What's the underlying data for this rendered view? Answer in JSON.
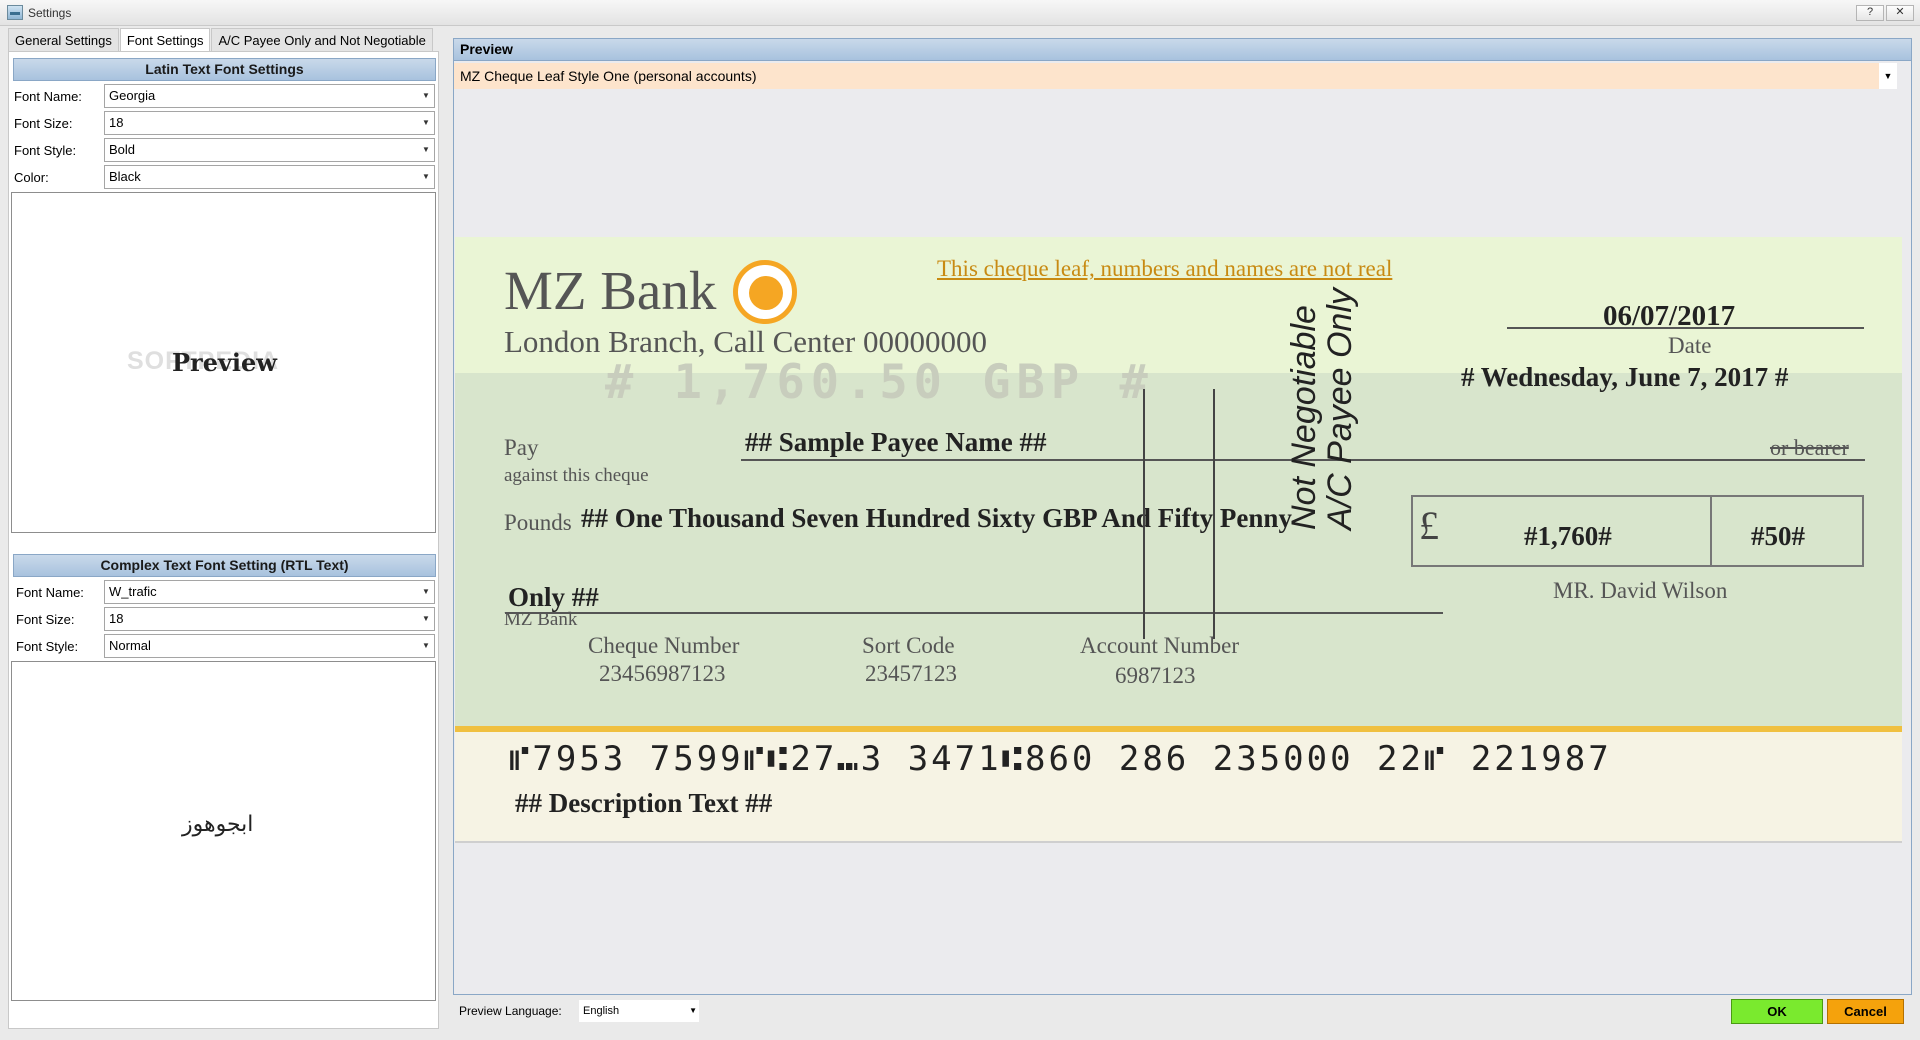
{
  "window": {
    "title": "Settings",
    "help_label": "?",
    "close_label": "✕"
  },
  "tabs": [
    {
      "label": "General Settings"
    },
    {
      "label": "Font Settings"
    },
    {
      "label": "A/C Payee Only and Not Negotiable"
    }
  ],
  "latin": {
    "header": "Latin Text Font Settings",
    "font_name_label": "Font Name:",
    "font_name_value": "Georgia",
    "font_size_label": "Font Size:",
    "font_size_value": "18",
    "font_style_label": "Font Style:",
    "font_style_value": "Bold",
    "color_label": "Color:",
    "color_value": "Black",
    "preview_text": "Preview",
    "watermark": "SOFTPEDIA"
  },
  "complex": {
    "header": "Complex Text Font Setting (RTL Text)",
    "font_name_label": "Font Name:",
    "font_name_value": "W_trafic",
    "font_size_label": "Font Size:",
    "font_size_value": "18",
    "font_style_label": "Font Style:",
    "font_style_value": "Normal",
    "preview_text": "ابجوهوز"
  },
  "preview": {
    "header": "Preview",
    "style_selected": "MZ Cheque Leaf Style One (personal accounts)"
  },
  "cheque": {
    "bank_name": "MZ Bank",
    "branch": "London Branch, Call Center 00000000",
    "notice": "This cheque leaf, numbers and names are not real",
    "dot_amount": "# 1,760.50 GBP #",
    "date": "06/07/2017",
    "date_label": "Date",
    "date_long": "# Wednesday, June 7, 2017 #",
    "pay_label": "Pay",
    "against_label": "against this cheque",
    "payee": "## Sample Payee Name ##",
    "bearer": "or bearer",
    "pounds_label": "Pounds",
    "amount_words": "## One Thousand Seven Hundred Sixty GBP And Fifty Penny",
    "only_text": "Only ##",
    "bank_small": "MZ Bank",
    "crossing_line1": "Not Negotiable",
    "crossing_line2": "A/C Payee Only",
    "currency_symbol": "£",
    "amount_number": "#1,760#",
    "amount_pence": "#50#",
    "account_holder": "MR. David Wilson",
    "cheque_number_label": "Cheque Number",
    "cheque_number": "23456987123",
    "sort_code_label": "Sort Code",
    "sort_code": "23457123",
    "account_number_label": "Account Number",
    "account_number": "6987123",
    "micr_line": "⑈7953 7599⑈⑆27⑉3 3471⑆860 286 235000 22⑈ 221987",
    "description": "## Description Text ##"
  },
  "footer": {
    "language_label": "Preview Language:",
    "language_value": "English",
    "ok_label": "OK",
    "cancel_label": "Cancel"
  },
  "colors": {
    "accent_header": "#a8c2de",
    "ok_button": "#7aea2e",
    "cancel_button": "#f5a20c",
    "cheque_top": "#eaf5d5",
    "cheque_body": "#d8e5cc",
    "cheque_stripe": "#f0c040"
  }
}
